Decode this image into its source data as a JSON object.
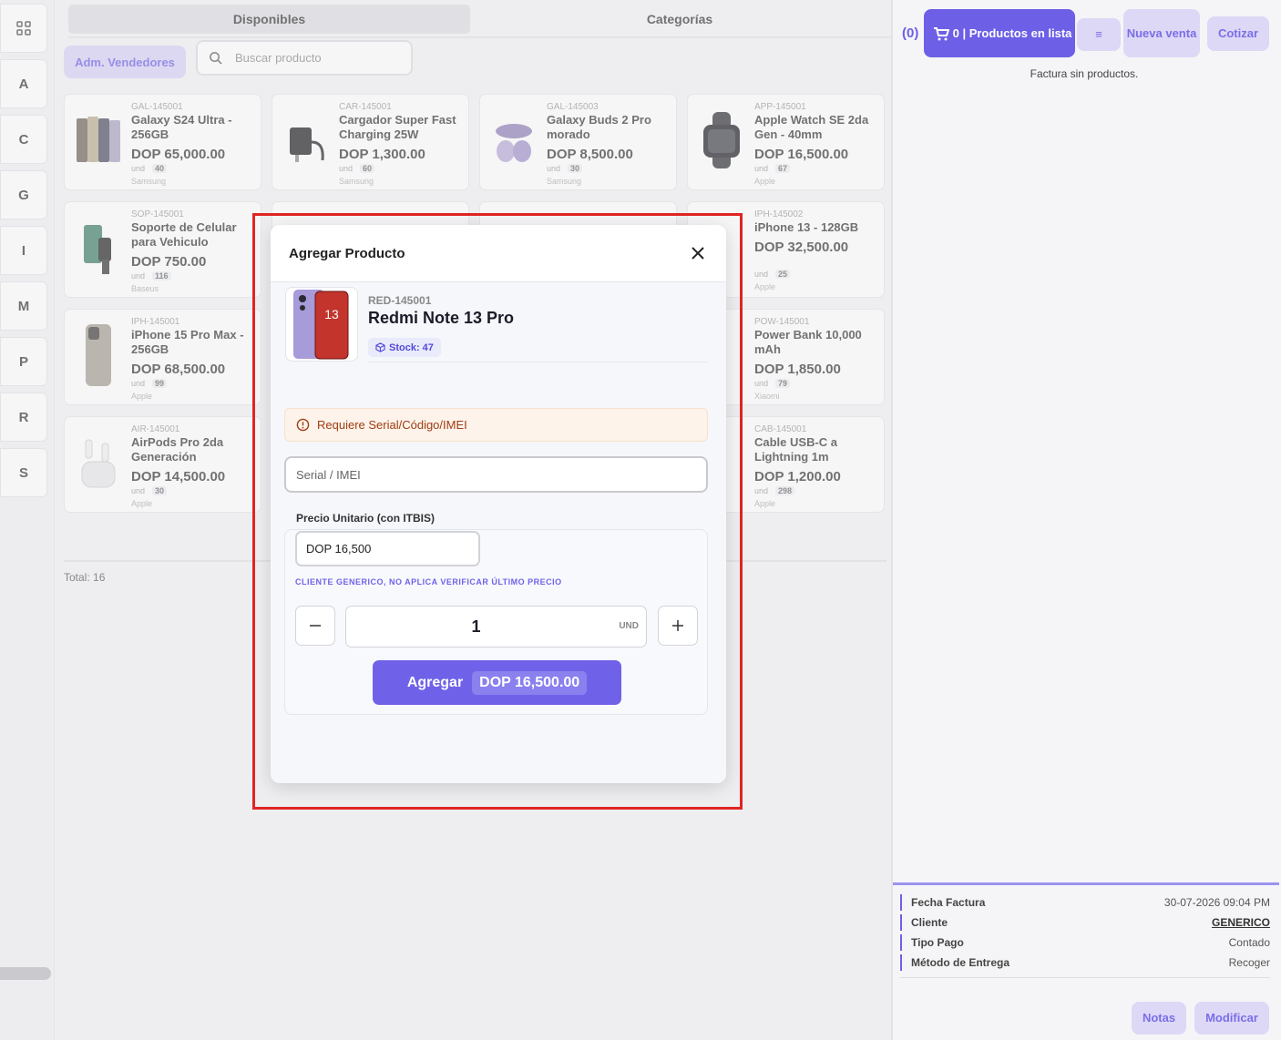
{
  "rail": {
    "letters": [
      "A",
      "C",
      "G",
      "I",
      "M",
      "P",
      "R",
      "S"
    ]
  },
  "tabs": {
    "available": "Disponibles",
    "categories": "Categorías"
  },
  "toolbar": {
    "sellers_button": "Adm. Vendedores",
    "search_placeholder": "Buscar producto"
  },
  "products": [
    {
      "sku": "GAL-145001",
      "name": "Galaxy S24 Ultra - 256GB",
      "price": "DOP 65,000.00",
      "unit": "und",
      "stock": "40",
      "brand": "Samsung"
    },
    {
      "sku": "CAR-145001",
      "name": "Cargador Super Fast Charging 25W",
      "price": "DOP 1,300.00",
      "unit": "und",
      "stock": "60",
      "brand": "Samsung"
    },
    {
      "sku": "GAL-145003",
      "name": "Galaxy Buds 2 Pro morado",
      "price": "DOP 8,500.00",
      "unit": "und",
      "stock": "30",
      "brand": "Samsung"
    },
    {
      "sku": "APP-145001",
      "name": "Apple Watch SE 2da Gen - 40mm",
      "price": "DOP 16,500.00",
      "unit": "und",
      "stock": "67",
      "brand": "Apple"
    },
    {
      "sku": "SOP-145001",
      "name": "Soporte de Celular para Vehiculo",
      "price": "DOP 750.00",
      "unit": "und",
      "stock": "116",
      "brand": "Baseus"
    },
    {
      "sku": "IPH-145002",
      "name": "iPhone 13 - 128GB",
      "price": "DOP 32,500.00",
      "unit": "und",
      "stock": "25",
      "brand": "Apple"
    },
    {
      "sku": "IPH-145001",
      "name": "iPhone 15 Pro Max - 256GB",
      "price": "DOP 68,500.00",
      "unit": "und",
      "stock": "99",
      "brand": "Apple"
    },
    {
      "sku": "POW-145001",
      "name": "Power Bank 10,000 mAh",
      "price": "DOP 1,850.00",
      "unit": "und",
      "stock": "79",
      "brand": "Xiaomi"
    },
    {
      "sku": "AIR-145001",
      "name": "AirPods Pro 2da Generación",
      "price": "DOP 14,500.00",
      "unit": "und",
      "stock": "30",
      "brand": "Apple"
    },
    {
      "sku": "CAB-145001",
      "name": "Cable USB-C a Lightning 1m",
      "price": "DOP 1,200.00",
      "unit": "und",
      "stock": "298",
      "brand": "Apple"
    }
  ],
  "footer": {
    "total": "Total: 16"
  },
  "cart": {
    "count": "(0)",
    "button_label": "0 | Productos en lista",
    "list_icon_label": "≡",
    "new_sale": "Nueva venta",
    "quote": "Cotizar",
    "empty_message": "Factura sin productos."
  },
  "invoice_info": [
    {
      "label": "Fecha Factura",
      "value": "30-07-2026 09:04 PM"
    },
    {
      "label": "Cliente",
      "value": "GENERICO"
    },
    {
      "label": "Tipo Pago",
      "value": "Contado"
    },
    {
      "label": "Método de Entrega",
      "value": "Recoger"
    }
  ],
  "actions": {
    "notes": "Notas",
    "modify": "Modificar"
  },
  "modal": {
    "title": "Agregar Producto",
    "product_sku": "RED-145001",
    "product_name": "Redmi Note 13 Pro",
    "stock": "Stock: 47",
    "warning": "Requiere Serial/Código/IMEI",
    "serial_placeholder": "Serial / IMEI",
    "price_label": "Precio Unitario (con ITBIS)",
    "price_value": "DOP 16,500",
    "generic_note": "CLIENTE GENERICO, NO APLICA VERIFICAR ÚLTIMO PRECIO",
    "quantity": "1",
    "unit": "UND",
    "add_label": "Agregar",
    "add_amount": "DOP 16,500.00"
  },
  "colors": {
    "accent": "#6d5fe6",
    "warning_text": "#a03c12",
    "highlight": "#e02424"
  }
}
